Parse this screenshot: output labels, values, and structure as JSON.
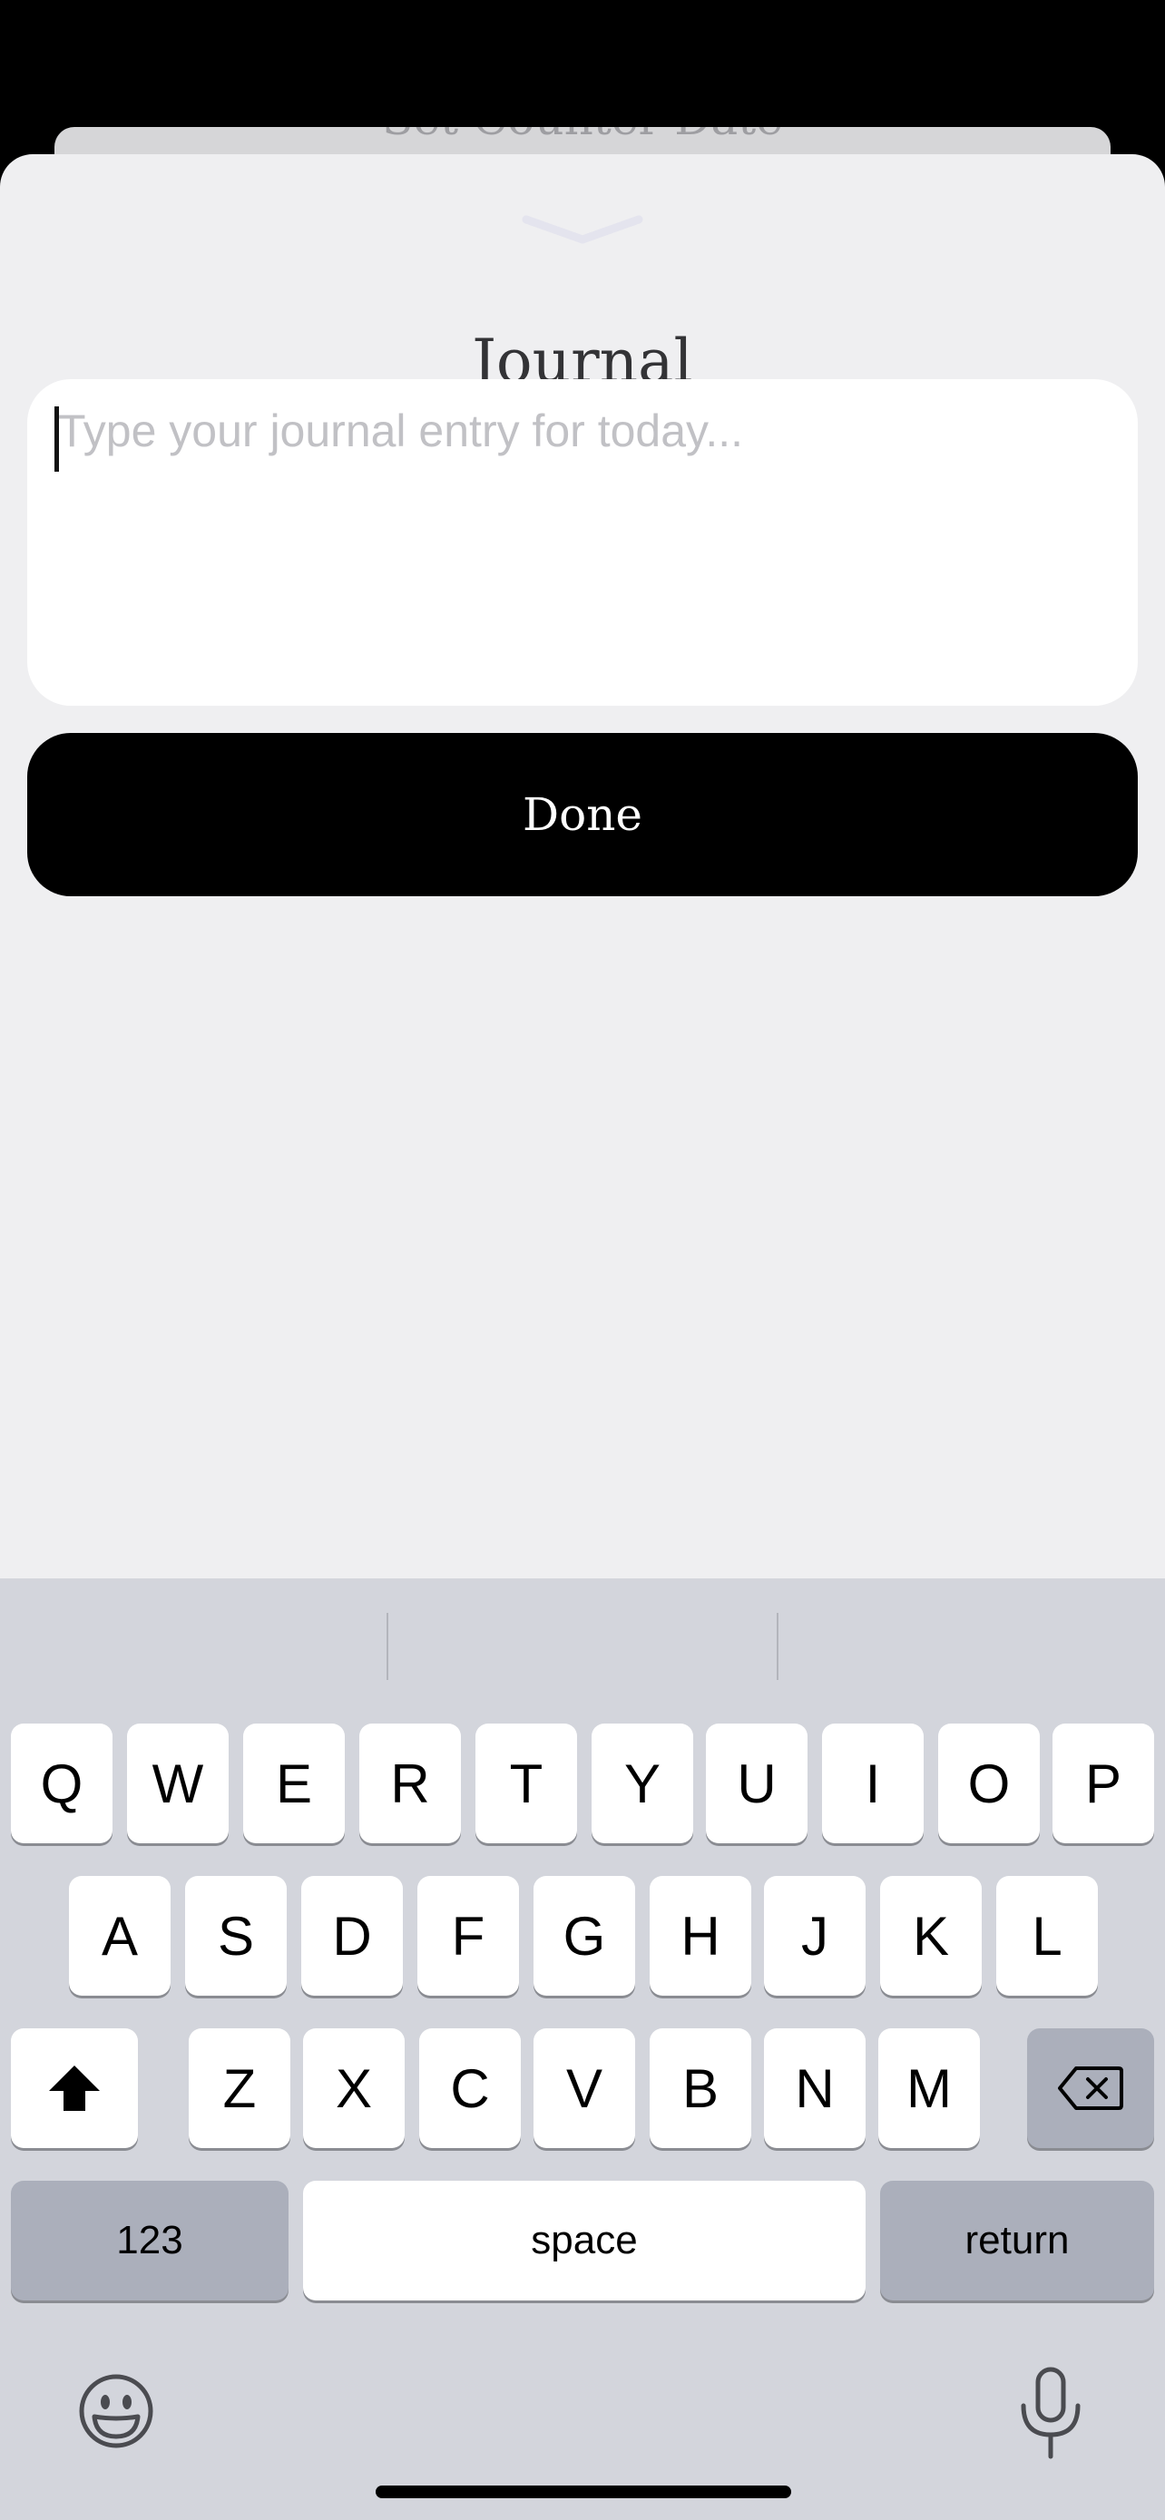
{
  "background_sheet": {
    "title": "Set Counter Date"
  },
  "sheet": {
    "title": "Journal",
    "entry": {
      "value": "",
      "placeholder": "Type your journal entry for today..."
    },
    "done_label": "Done"
  },
  "keyboard": {
    "rows": [
      [
        "Q",
        "W",
        "E",
        "R",
        "T",
        "Y",
        "U",
        "I",
        "O",
        "P"
      ],
      [
        "A",
        "S",
        "D",
        "F",
        "G",
        "H",
        "J",
        "K",
        "L"
      ],
      [
        "Z",
        "X",
        "C",
        "V",
        "B",
        "N",
        "M"
      ]
    ],
    "numbers_label": "123",
    "space_label": "space",
    "return_label": "return",
    "icons": {
      "shift": "shift-icon",
      "delete": "backspace-icon",
      "emoji": "emoji-icon",
      "dictation": "microphone-icon"
    }
  },
  "colors": {
    "sheet_bg": "#efeff1",
    "keyboard_bg": "#d3d5dc",
    "button_bg": "#000000",
    "accent_text": "#333336"
  }
}
